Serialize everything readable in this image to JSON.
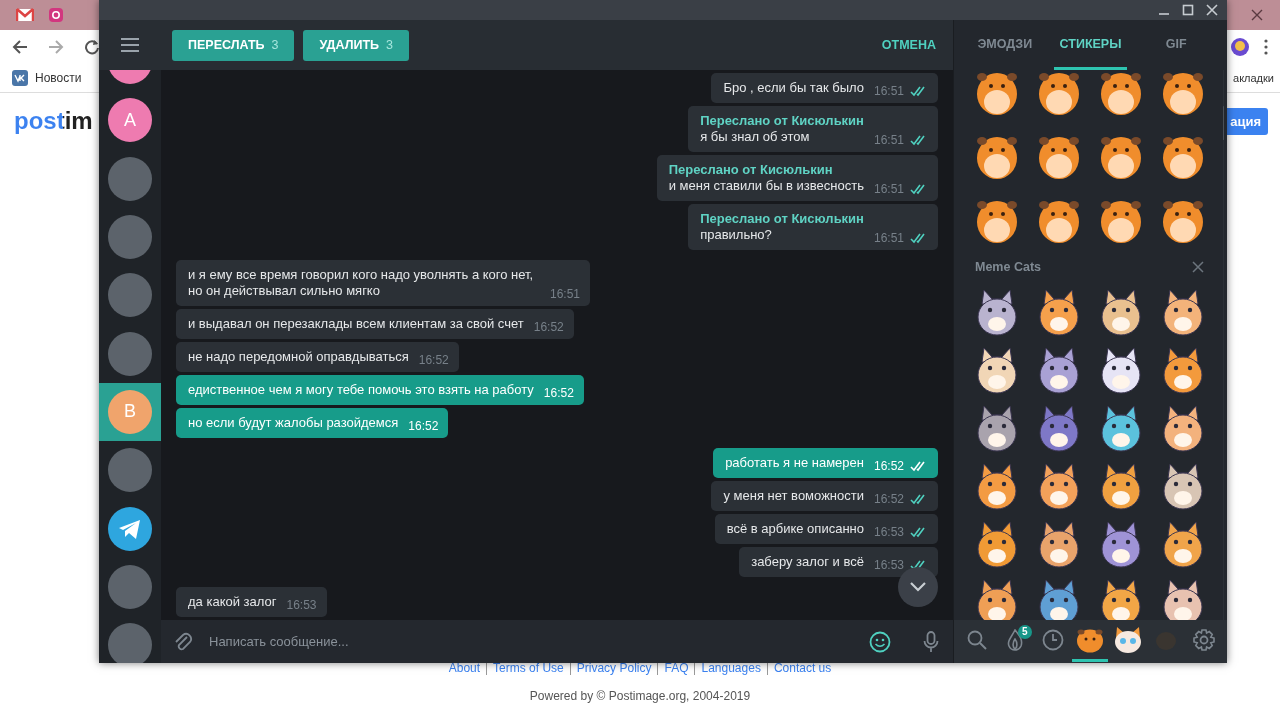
{
  "browser": {
    "bookmark": "Новости",
    "bookmarks_label": "акладки",
    "logo": "postim",
    "page_button": "ация",
    "footer_links": [
      "About",
      "Terms of Use",
      "Privacy Policy",
      "FAQ",
      "Languages",
      "Contact us"
    ],
    "footer": "Powered by © Postimage.org, 2004-2019"
  },
  "telegram": {
    "header": {
      "actions": [
        {
          "label": "ПЕРЕСЛАТЬ",
          "count": "3"
        },
        {
          "label": "УДАЛИТЬ",
          "count": "3"
        }
      ],
      "cancel": "ОТМЕНА"
    },
    "chats": [
      {
        "kind": "letter",
        "color": "#ee7bb0",
        "selected": false
      },
      {
        "kind": "letter",
        "letter": "А",
        "color": "#ee7bb0",
        "selected": false
      },
      {
        "kind": "photo",
        "selected": false
      },
      {
        "kind": "photo",
        "selected": false
      },
      {
        "kind": "photo",
        "selected": false
      },
      {
        "kind": "photo",
        "selected": false
      },
      {
        "kind": "letter",
        "letter": "В",
        "color": "#f0a46c",
        "selected": true
      },
      {
        "kind": "photo",
        "selected": false
      },
      {
        "kind": "telegram",
        "selected": false
      },
      {
        "kind": "photo",
        "selected": false
      },
      {
        "kind": "photo",
        "selected": false
      }
    ],
    "messages": [
      {
        "kind": "out",
        "text": "Бро , если бы так было",
        "time": "16:51",
        "read": true,
        "selected": false
      },
      {
        "kind": "out",
        "forwarded_from": "Переслано от Кисюлькин",
        "text": "я бы знал об этом",
        "time": "16:51",
        "read": true,
        "selected": false
      },
      {
        "kind": "out",
        "forwarded_from": "Переслано от Кисюлькин",
        "text": "и меня ставили бы в извесность",
        "time": "16:51",
        "read": true,
        "selected": false
      },
      {
        "kind": "out",
        "forwarded_from": "Переслано от Кисюлькин",
        "text": "правильно?",
        "time": "16:51",
        "read": true,
        "selected": false
      },
      {
        "kind": "in",
        "text": "и я ему все время говорил кого надо уволнять а кого нет, но он действывал сильно мягко",
        "time": "16:51",
        "selected": false
      },
      {
        "kind": "in",
        "text": "и выдавал он перезаклады всем клиентам за свой счет",
        "time": "16:52",
        "selected": false
      },
      {
        "kind": "in",
        "text": "не надо передомной оправдываться",
        "time": "16:52",
        "selected": false
      },
      {
        "kind": "in",
        "text": "едиственное чем я могу тебе помочь это взять на работу",
        "time": "16:52",
        "selected": true
      },
      {
        "kind": "in",
        "text": "но если будут жалобы разойдемся",
        "time": "16:52",
        "selected": true
      },
      {
        "kind": "out",
        "text": "работать я не намерен",
        "time": "16:52",
        "read": true,
        "selected": true
      },
      {
        "kind": "out",
        "text": "у меня нет воможности",
        "time": "16:52",
        "read": true,
        "selected": false
      },
      {
        "kind": "out",
        "text": "всё в арбике описанно",
        "time": "16:53",
        "read": true,
        "selected": false
      },
      {
        "kind": "out",
        "text": "заберу залог и всё",
        "time": "16:53",
        "read": true,
        "selected": false
      },
      {
        "kind": "in",
        "text": "да какой залог",
        "time": "16:53",
        "selected": false
      }
    ],
    "composer": {
      "placeholder": "Написать сообщение..."
    },
    "sticker_tabs": [
      {
        "label": "ЭМОДЗИ",
        "selected": false
      },
      {
        "label": "СТИКЕРЫ",
        "selected": true
      },
      {
        "label": "GIF",
        "selected": false
      }
    ],
    "sticker_sets": [
      {
        "kind": "hamster"
      },
      {
        "kind": "cat",
        "title": "Meme Cats"
      }
    ],
    "sticker_bar": [
      {
        "kind": "search",
        "selected": false
      },
      {
        "kind": "trending",
        "badge": "5",
        "selected": false
      },
      {
        "kind": "recent",
        "selected": false
      },
      {
        "kind": "hamster",
        "selected": true
      },
      {
        "kind": "cat",
        "selected": false
      },
      {
        "kind": "dim",
        "selected": false
      },
      {
        "kind": "settings",
        "selected": false
      }
    ]
  }
}
